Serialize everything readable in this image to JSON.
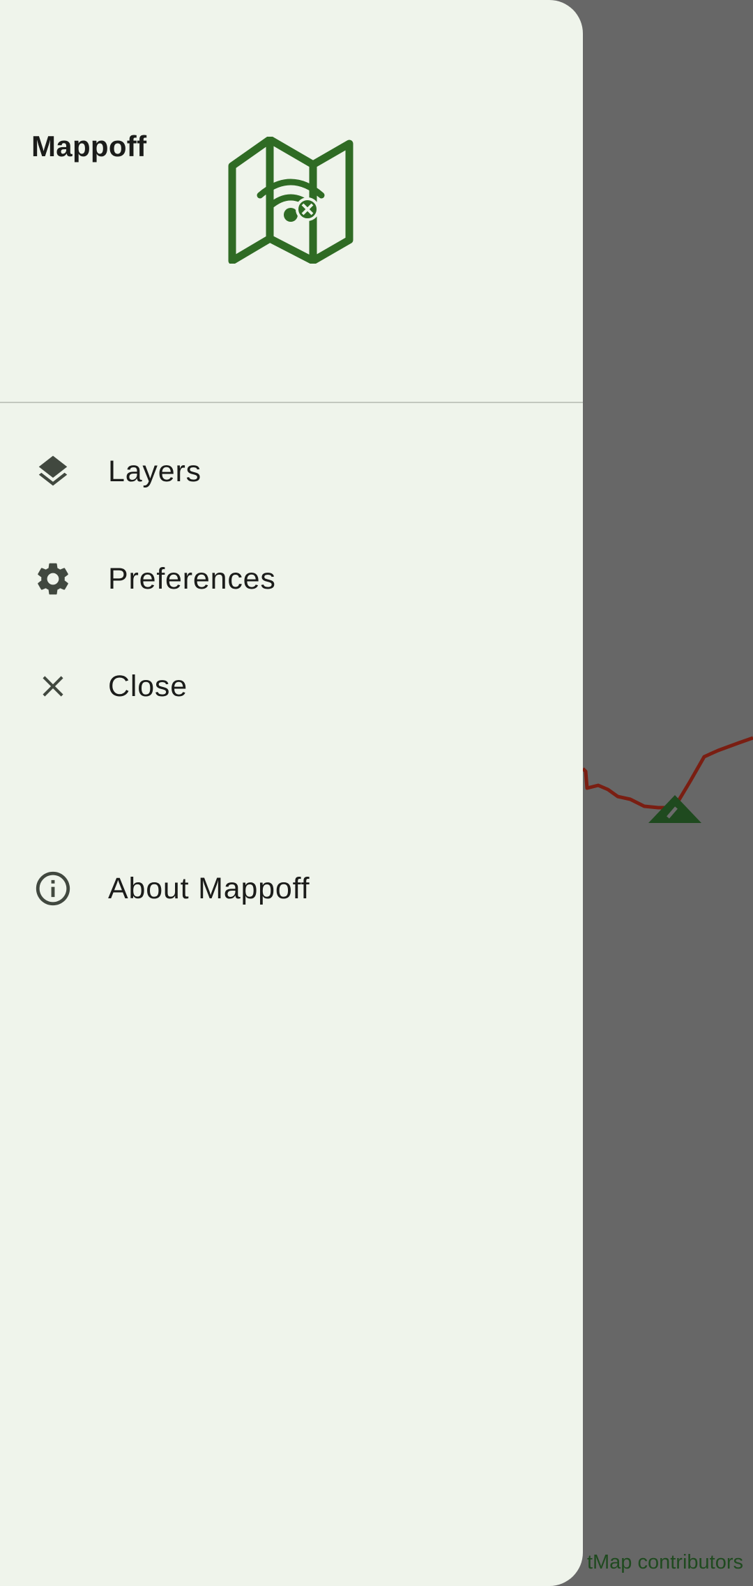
{
  "app": {
    "title": "Mappoff"
  },
  "drawer": {
    "items": [
      {
        "id": "layers",
        "label": "Layers",
        "icon": "layers-icon"
      },
      {
        "id": "preferences",
        "label": "Preferences",
        "icon": "gear-icon"
      },
      {
        "id": "close",
        "label": "Close",
        "icon": "close-icon"
      },
      {
        "id": "about",
        "label": "About Mappoff",
        "icon": "info-icon"
      }
    ]
  },
  "map": {
    "attribution": "tMap contributors",
    "controls": {
      "compass": "navigation-arrow-icon",
      "zoom_in": "zoom-in-icon",
      "zoom_out": "zoom-out-icon"
    }
  },
  "colors": {
    "drawer_background": "#eff4eb",
    "scrim_map": "#676767",
    "brand_green": "#2f6b24",
    "track_red": "#7a1e12",
    "icon_dark": "#41483f"
  }
}
